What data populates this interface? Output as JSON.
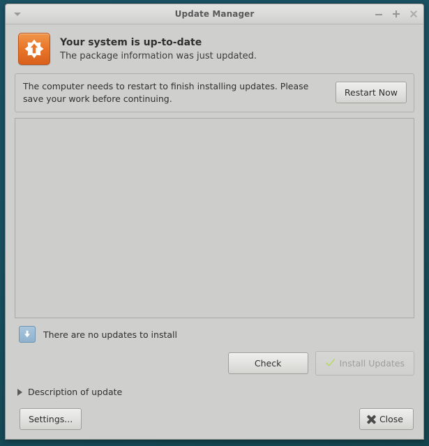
{
  "window": {
    "title": "Update Manager",
    "menu_icon": "chevron-down-icon",
    "controls": {
      "minimize": "minimize-icon",
      "maximize": "maximize-icon",
      "close": "close-icon"
    }
  },
  "status_header": {
    "icon": "update-manager-star-arrow-icon",
    "title": "Your system is up-to-date",
    "subtitle": "The package information was just updated."
  },
  "restart_bar": {
    "message": "The computer needs to restart to finish installing updates. Please save your work before continuing.",
    "button_label": "Restart Now"
  },
  "updates_list": {
    "items": []
  },
  "status_row": {
    "icon": "download-arrow-icon",
    "text": "There are no updates to install"
  },
  "actions": {
    "check_label": "Check",
    "install_label": "Install Updates",
    "install_icon": "green-checkmark-icon",
    "install_disabled": true
  },
  "description": {
    "toggle_icon": "triangle-right-icon",
    "label": "Description of update",
    "expanded": false
  },
  "footer": {
    "settings_label": "Settings...",
    "close_label": "Close",
    "close_icon": "x-mark-icon"
  },
  "colors": {
    "accent_orange": "#e8762a",
    "desktop_teal": "#1b5264",
    "window_bg": "#cfcfcd",
    "list_bg": "#cdcdcb",
    "checkmark_green": "#a8c94f"
  }
}
